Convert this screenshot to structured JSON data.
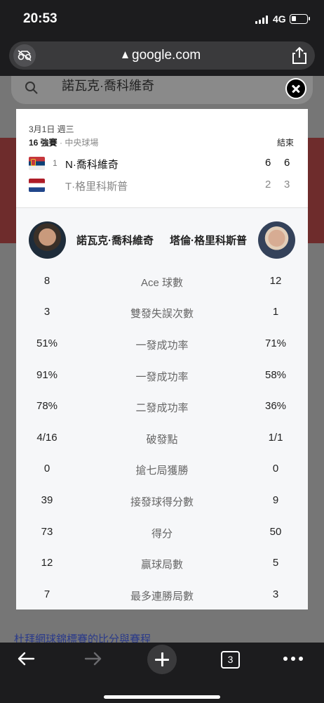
{
  "status_bar": {
    "time": "20:53",
    "network": "4G"
  },
  "browser": {
    "url": "google.com",
    "tab_count": "3"
  },
  "background_page": {
    "search_query": "諾瓦克·喬科維奇",
    "bottom_link": "杜拜網球錦標賽的比分與賽程"
  },
  "match": {
    "date": "3月1日 週三",
    "round": "16 強賽",
    "separator": " · ",
    "venue": "中央球場",
    "status": "結束",
    "players": [
      {
        "seed": "1",
        "name": "N·喬科維奇",
        "set1": "6",
        "set2": "6",
        "flag": "serbia",
        "winner": true
      },
      {
        "seed": "",
        "name": "T·格里科斯普",
        "set1": "2",
        "set2": "3",
        "flag": "netherlands",
        "winner": false
      }
    ]
  },
  "stats": {
    "left_player": "諾瓦克·喬科維奇",
    "right_player": "塔倫·格里科斯普",
    "rows": [
      {
        "left": "8",
        "label": "Ace 球數",
        "right": "12"
      },
      {
        "left": "3",
        "label": "雙發失誤次數",
        "right": "1"
      },
      {
        "left": "51%",
        "label": "一發成功率",
        "right": "71%"
      },
      {
        "left": "91%",
        "label": "一發成功率",
        "right": "58%"
      },
      {
        "left": "78%",
        "label": "二發成功率",
        "right": "36%"
      },
      {
        "left": "4/16",
        "label": "破發點",
        "right": "1/1"
      },
      {
        "left": "0",
        "label": "搶七局獲勝",
        "right": "0"
      },
      {
        "left": "39",
        "label": "接發球得分數",
        "right": "9"
      },
      {
        "left": "73",
        "label": "得分",
        "right": "50"
      },
      {
        "left": "12",
        "label": "贏球局數",
        "right": "5"
      },
      {
        "left": "7",
        "label": "最多連勝局數",
        "right": "3"
      }
    ]
  },
  "colors": {
    "background": "#1c1c1e",
    "card": "#ffffff",
    "stats_bg": "#f6f7f9"
  }
}
